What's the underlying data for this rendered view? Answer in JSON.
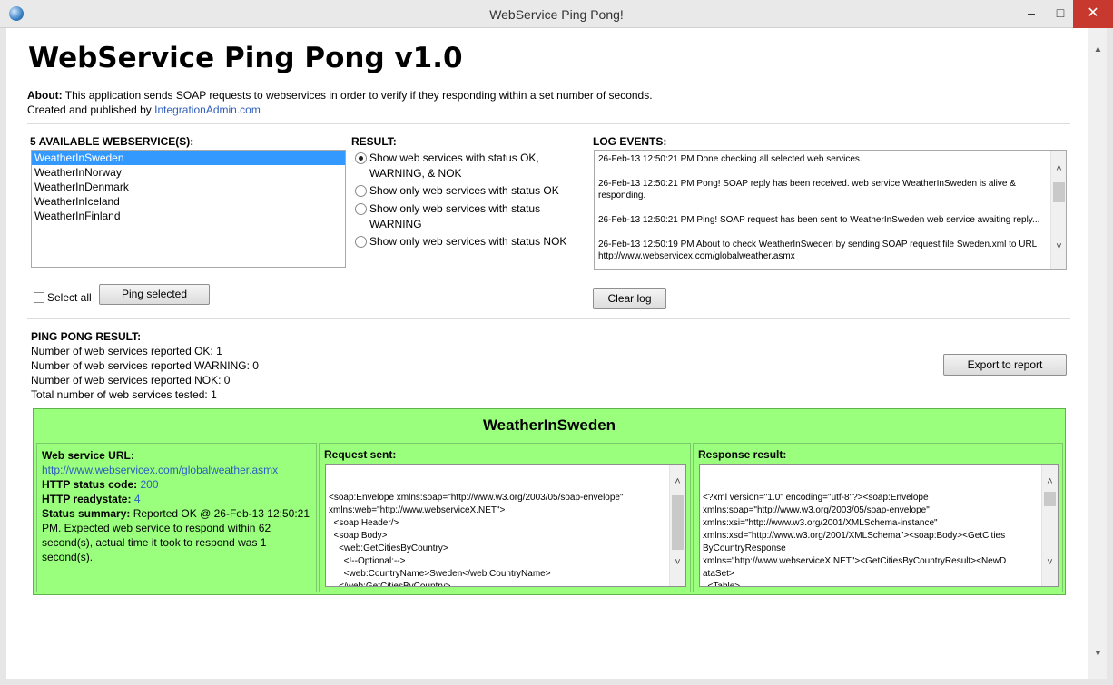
{
  "window": {
    "title": "WebService Ping Pong!",
    "minimize_glyph": "–",
    "maximize_glyph": "□",
    "close_glyph": "✕"
  },
  "header": {
    "app_title": "WebService Ping Pong v1.0",
    "about_label": "About:",
    "about_text": "This application sends SOAP requests to webservices in order to verify if they responding within a set number of seconds.",
    "created_text": "Created and published by",
    "created_link": "IntegrationAdmin.com"
  },
  "services": {
    "label": "5 AVAILABLE WEBSERVICE(S):",
    "items": [
      "WeatherInSweden",
      "WeatherInNorway",
      "WeatherInDenmark",
      "WeatherInIceland",
      "WeatherInFinland"
    ],
    "selected_index": 0,
    "select_all_label": "Select all",
    "ping_button": "Ping selected"
  },
  "result_filter": {
    "label": "RESULT:",
    "options": [
      "Show web services with status OK, WARNING, & NOK",
      "Show only web services with status OK",
      "Show only web services with status WARNING",
      "Show only web services with status NOK"
    ],
    "selected_index": 0
  },
  "log": {
    "label": "LOG EVENTS:",
    "entries": [
      "26-Feb-13 12:50:21 PM Done checking all selected web services.",
      "26-Feb-13 12:50:21 PM Pong! SOAP reply has been received. web service WeatherInSweden is alive & responding.",
      "26-Feb-13 12:50:21 PM Ping! SOAP request has been sent to WeatherInSweden web service awaiting reply...",
      "26-Feb-13 12:50:19 PM About to check WeatherInSweden by sending SOAP request file Sweden.xml to URL http://www.webservicex.com/globalweather.asmx"
    ],
    "clear_button": "Clear log"
  },
  "ping_result": {
    "label": "PING PONG RESULT:",
    "lines": [
      "Number of web services reported OK: 1",
      "Number of web services reported WARNING: 0",
      "Number of web services reported NOK: 0",
      "Total number of web services tested: 1"
    ],
    "export_button": "Export to report"
  },
  "detail": {
    "service_name": "WeatherInSweden",
    "url_label": "Web service URL:",
    "url": "http://www.webservicex.com/globalweather.asmx",
    "status_code_label": "HTTP status code:",
    "status_code": "200",
    "readystate_label": "HTTP readystate:",
    "readystate": "4",
    "summary_label": "Status summary:",
    "summary_text": "Reported OK @ 26-Feb-13 12:50:21 PM. Expected web service to respond within 62 second(s), actual time it took to respond was 1 second(s).",
    "request_label": "Request sent:",
    "request_body": "<soap:Envelope xmlns:soap=\"http://www.w3.org/2003/05/soap-envelope\"\nxmlns:web=\"http://www.webserviceX.NET\">\n  <soap:Header/>\n  <soap:Body>\n    <web:GetCitiesByCountry>\n      <!--Optional:-->\n      <web:CountryName>Sweden</web:CountryName>\n    </web:GetCitiesByCountry>\n  </soap:Body>\n</soap:Envelope>",
    "response_label": "Response result:",
    "response_body": "<?xml version=\"1.0\" encoding=\"utf-8\"?><soap:Envelope\nxmlns:soap=\"http://www.w3.org/2003/05/soap-envelope\"\nxmlns:xsi=\"http://www.w3.org/2001/XMLSchema-instance\"\nxmlns:xsd=\"http://www.w3.org/2001/XMLSchema\"><soap:Body><GetCities\nByCountryResponse\nxmlns=\"http://www.webserviceX.NET\"><GetCitiesByCountryResult><NewD\nataSet>\n  <Table>\n    <Country>Sweden</Country>\n    <City>Linkoping / Malmen</City>"
  },
  "colors": {
    "panel_green": "#99ff7d",
    "link_blue": "#2e5ebe",
    "selection_blue": "#3399ff",
    "close_red": "#c7392e"
  }
}
